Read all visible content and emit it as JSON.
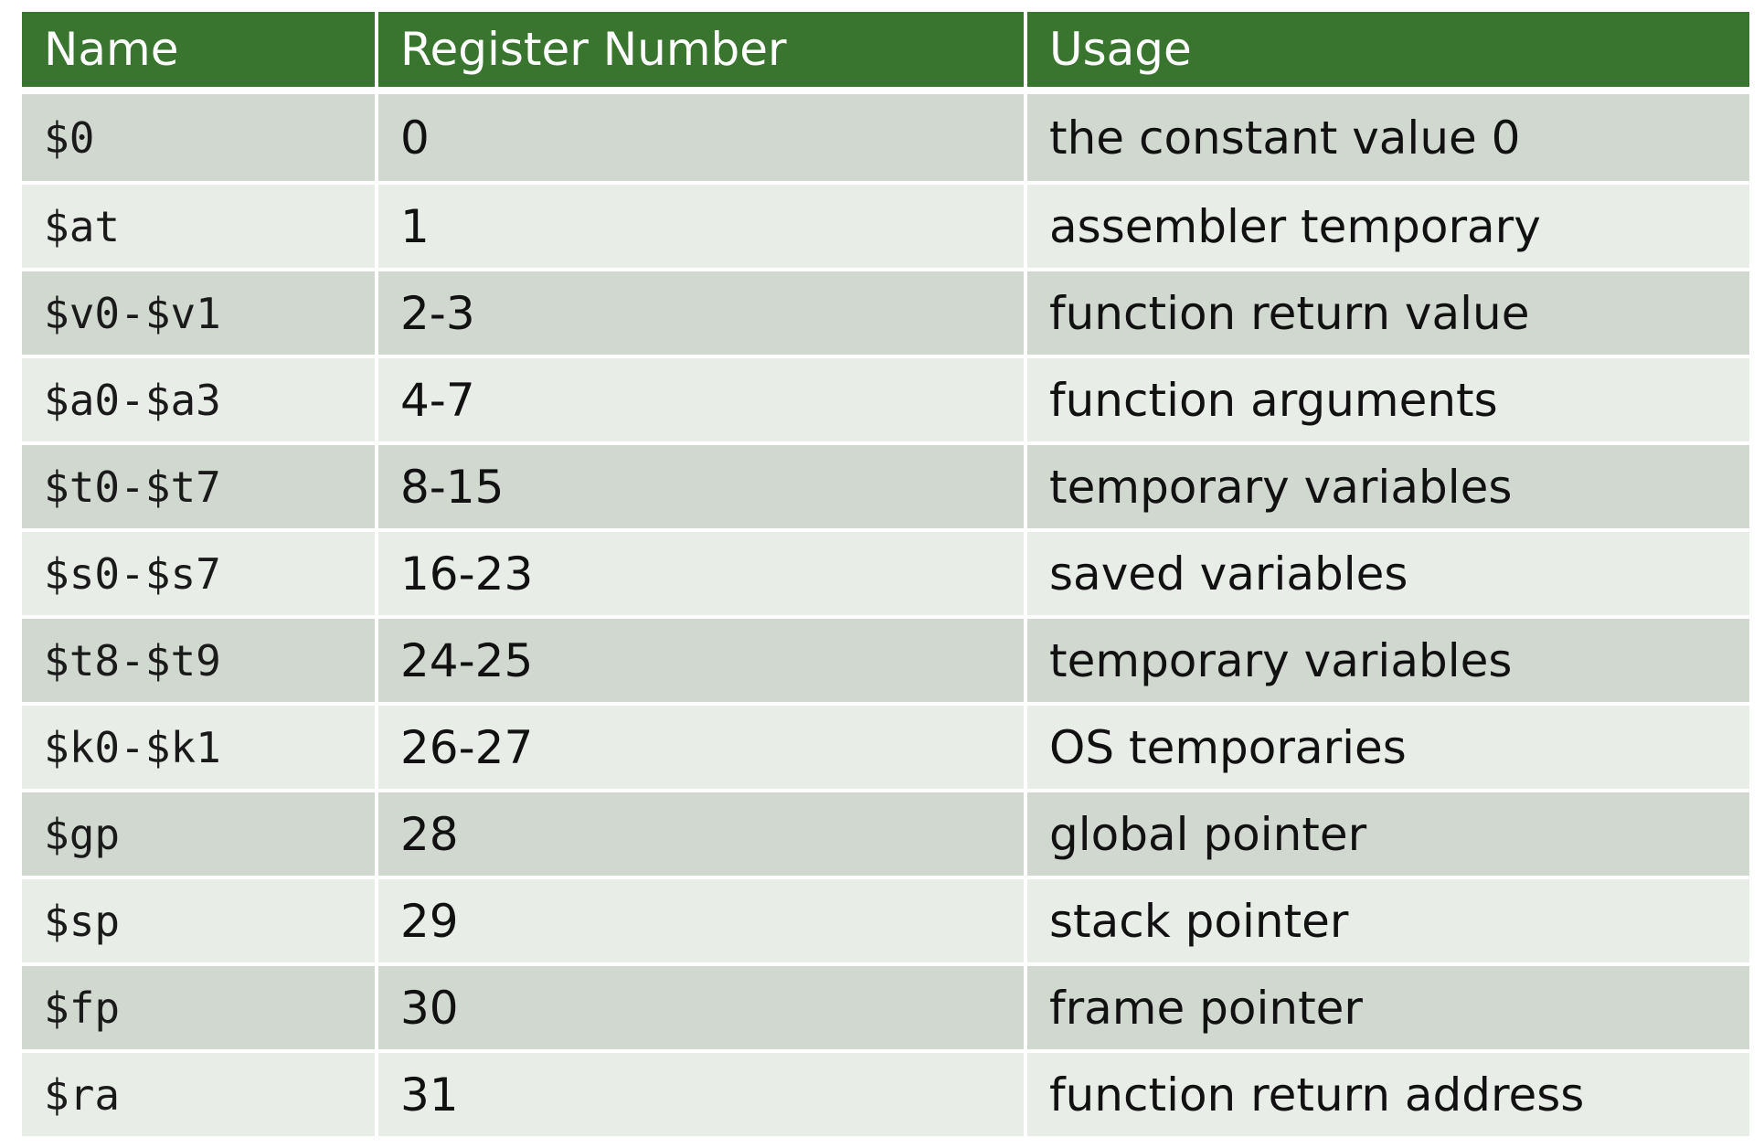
{
  "table": {
    "headers": [
      "Name",
      "Register Number",
      "Usage"
    ],
    "rows": [
      {
        "name": "$0",
        "number": "0",
        "usage": "the constant value 0"
      },
      {
        "name": "$at",
        "number": "1",
        "usage": "assembler temporary"
      },
      {
        "name": "$v0-$v1",
        "number": "2-3",
        "usage": "function return value"
      },
      {
        "name": "$a0-$a3",
        "number": "4-7",
        "usage": "function arguments"
      },
      {
        "name": "$t0-$t7",
        "number": "8-15",
        "usage": "temporary variables"
      },
      {
        "name": "$s0-$s7",
        "number": "16-23",
        "usage": "saved variables"
      },
      {
        "name": "$t8-$t9",
        "number": "24-25",
        "usage": "temporary variables"
      },
      {
        "name": "$k0-$k1",
        "number": "26-27",
        "usage": "OS temporaries"
      },
      {
        "name": "$gp",
        "number": "28",
        "usage": "global pointer"
      },
      {
        "name": "$sp",
        "number": "29",
        "usage": "stack pointer"
      },
      {
        "name": "$fp",
        "number": "30",
        "usage": "frame pointer"
      },
      {
        "name": "$ra",
        "number": "31",
        "usage": "function return address"
      }
    ]
  },
  "colors": {
    "header_bg": "#3a7530",
    "row_dark": "#d0d8d0",
    "row_light": "#e8ede8"
  }
}
